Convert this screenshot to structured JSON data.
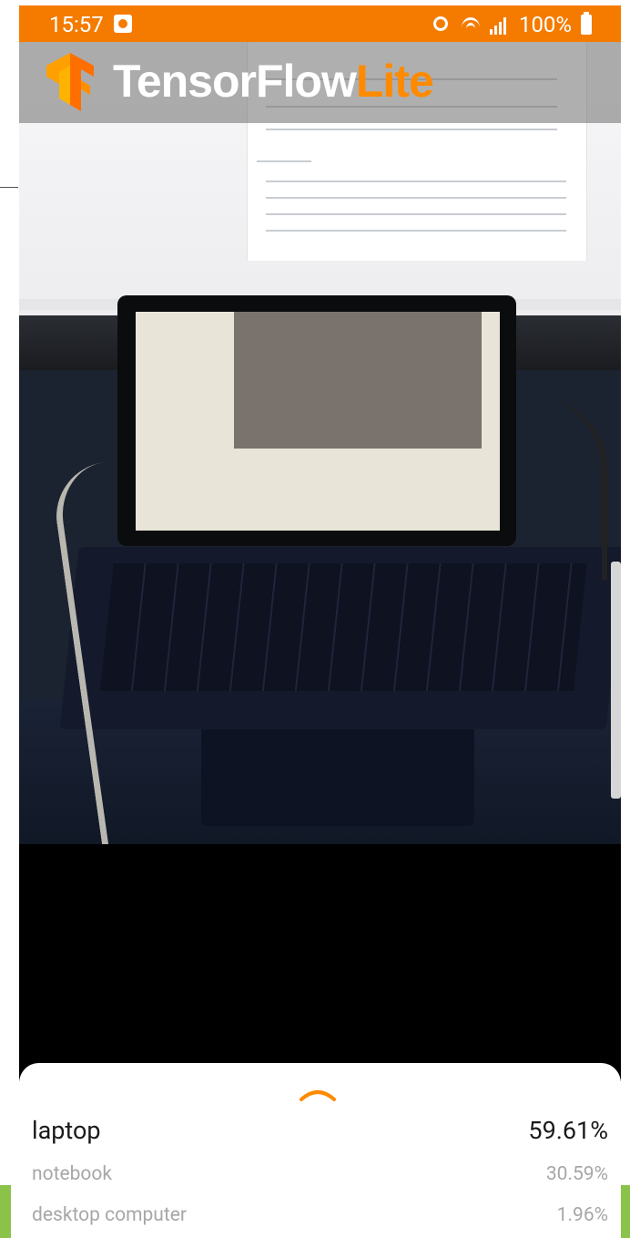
{
  "status_bar": {
    "time": "15:57",
    "battery": "100%",
    "background_color": "#f47b00"
  },
  "app": {
    "logo_main": "TensorFlow",
    "logo_accent": "Lite",
    "accent_color": "#ff8a00"
  },
  "results": [
    {
      "label": "laptop",
      "confidence": "59.61%"
    },
    {
      "label": "notebook",
      "confidence": "30.59%"
    },
    {
      "label": "desktop computer",
      "confidence": "1.96%"
    }
  ],
  "icons": {
    "status": [
      "photo-icon",
      "alarm-icon",
      "wifi-icon",
      "signal-icon",
      "battery-icon"
    ],
    "sheet": "chevron-up-icon"
  }
}
